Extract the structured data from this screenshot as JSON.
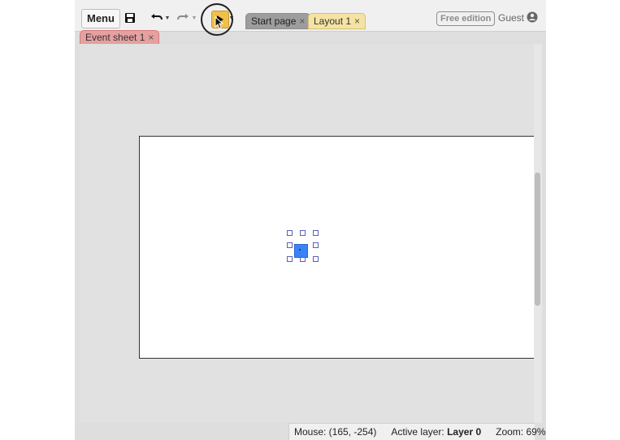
{
  "toolbar": {
    "menu_label": "Menu",
    "save_icon": "save-icon",
    "undo_icon": "undo-icon",
    "redo_icon": "redo-icon",
    "play_icon": "play-icon"
  },
  "tabs": [
    {
      "label": "Start page",
      "close": "×"
    },
    {
      "label": "Layout 1",
      "close": "×"
    }
  ],
  "edition_badge": "Free edition",
  "user": {
    "label": "Guest",
    "icon": "user-avatar-icon"
  },
  "event_tab": {
    "label": "Event sheet 1",
    "close": "×"
  },
  "status": {
    "mouse": "Mouse: (165, -254)",
    "active_layer_label": "Active layer:",
    "active_layer_value": "Layer 0",
    "zoom": "Zoom: 69%"
  },
  "colors": {
    "play_button": "#f1c04a",
    "layout_tab": "#f4e3a3",
    "event_tab": "#e6a0a0",
    "sprite": "#3b82f6"
  }
}
